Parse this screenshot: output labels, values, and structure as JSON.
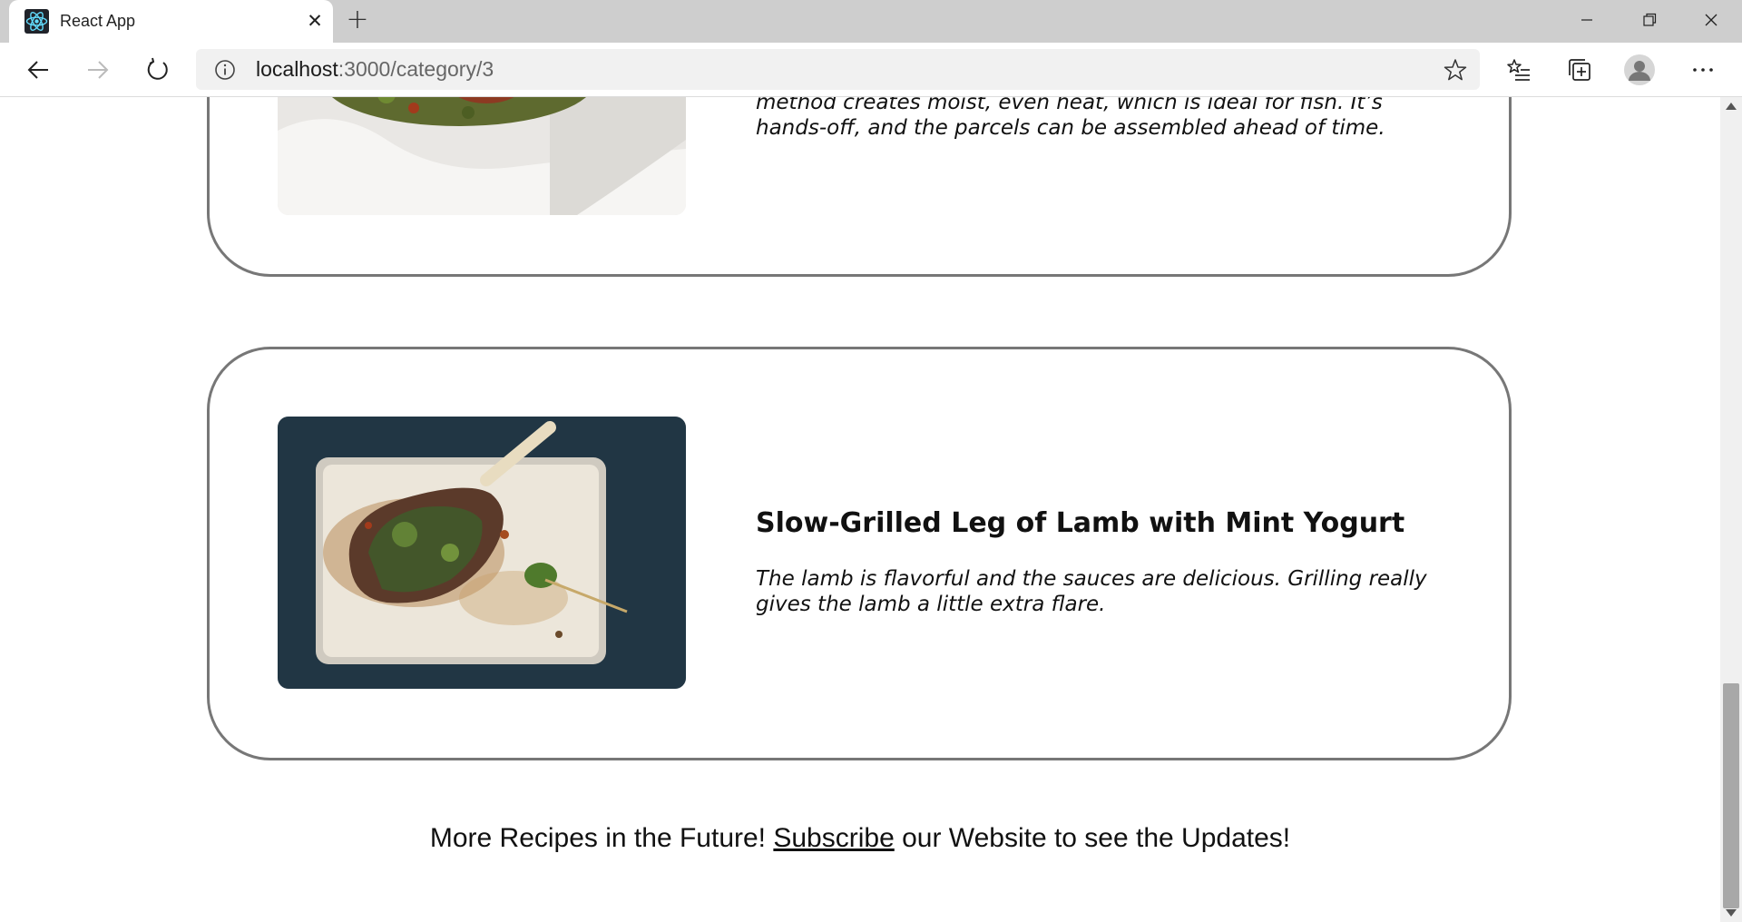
{
  "browser": {
    "tab_title": "React App",
    "url_host": "localhost",
    "url_path": ":3000/category/3"
  },
  "recipes": [
    {
      "title": "",
      "description": "method creates moist, even heat, which is ideal for fish. It’s hands-off, and the parcels can be assembled ahead of time.",
      "image": "fish-parcel-photo"
    },
    {
      "title": "Slow-Grilled Leg of Lamb with Mint Yogurt",
      "description": "The lamb is flavorful and the sauces are delicious. Grilling really gives the lamb a little extra flare.",
      "image": "grilled-lamb-leg-photo"
    }
  ],
  "footer": {
    "before": "More Recipes in the Future! ",
    "link": "Subscribe",
    "after": " our Website to see the Updates!"
  },
  "colors": {
    "titlebar": "#cecece",
    "card_border": "#777777",
    "react_logo": "#61dafb"
  }
}
